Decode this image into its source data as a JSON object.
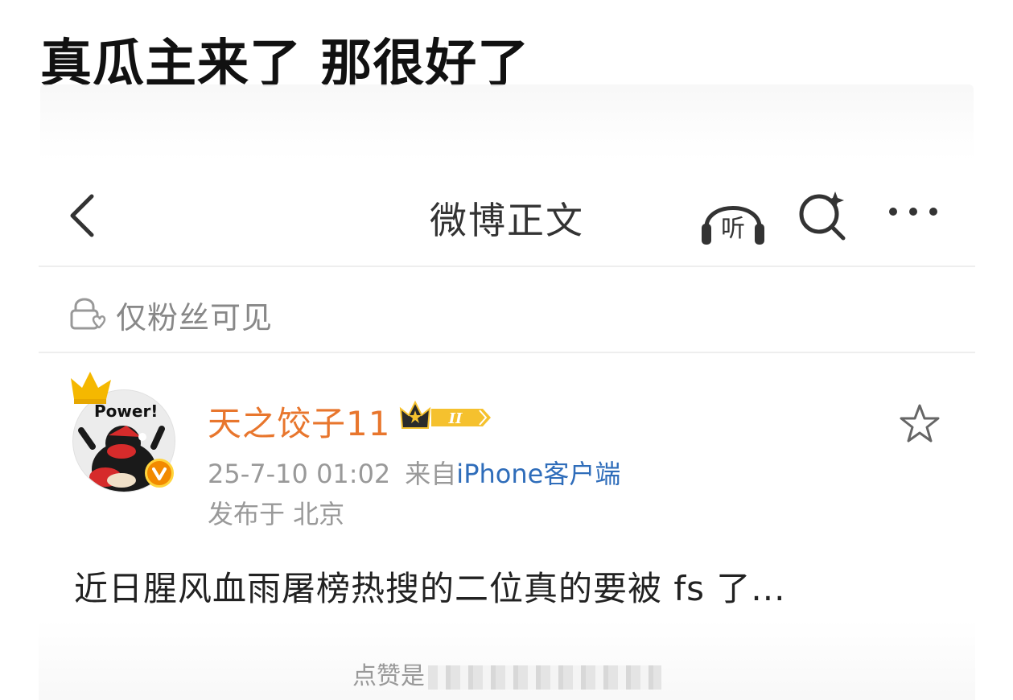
{
  "headline": "真瓜主来了 那很好了",
  "nav": {
    "title": "微博正文",
    "listen_label": "听"
  },
  "visibility": {
    "label": "仅粉丝可见"
  },
  "post": {
    "avatar_text": "Power!",
    "username": "天之饺子11",
    "level_badge": "II",
    "time": "25-7-10 01:02",
    "from_prefix": "来自",
    "client": "iPhone客户端",
    "location": "发布于 北京",
    "text": "近日腥风血雨屠榜热搜的二位真的要被 fs 了...",
    "like_hint": "点赞是"
  },
  "colors": {
    "username": "#e8762d",
    "client_link": "#2f6dba",
    "verified": "#f28a00",
    "crown": "#f5b800"
  }
}
